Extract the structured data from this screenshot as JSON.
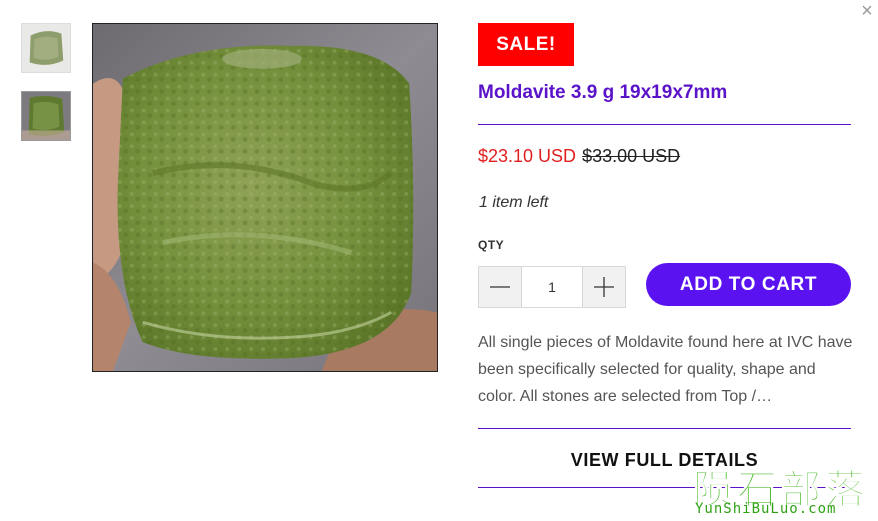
{
  "icons": {
    "close": "close-icon",
    "minus": "minus-icon",
    "plus": "plus-icon"
  },
  "colors": {
    "accent": "#5a13c9",
    "button": "#5a13f0",
    "sale_badge": "#ff0000",
    "sale_price": "#e02020",
    "watermark": "#3fb51a"
  },
  "gallery": {
    "thumbnails": [
      "moldavite-thumb-1",
      "moldavite-thumb-2"
    ],
    "main_image": "moldavite-photo"
  },
  "product": {
    "badge": "SALE!",
    "title": "Moldavite 3.9 g 19x19x7mm",
    "sale_price": "$23.10 USD",
    "compare_price": "$33.00 USD",
    "stock": "1 item left",
    "qty_label": "QTY",
    "qty_value": "1",
    "add_to_cart": "ADD TO CART",
    "description": "All single pieces of Moldavite found here at IVC have been specifically selected for quality, shape and color. All stones are selected from Top /…",
    "view_details": "VIEW FULL DETAILS"
  },
  "watermark": {
    "cn": "陨石部落",
    "en": "YunShiBuLuo.com"
  }
}
